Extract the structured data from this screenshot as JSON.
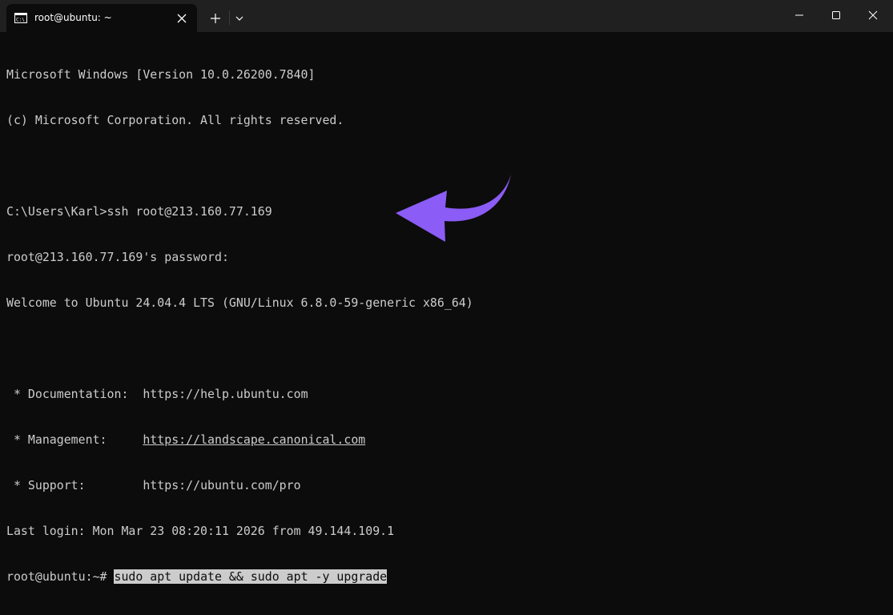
{
  "window": {
    "tab_title": "root@ubuntu: ~",
    "icons": {
      "tab": "terminal-icon",
      "close_tab": "close-icon",
      "new_tab": "plus-icon",
      "dropdown": "chevron-down-icon",
      "minimize": "minimize-icon",
      "maximize": "maximize-icon",
      "close": "close-icon"
    }
  },
  "terminal": {
    "lines": {
      "l1": "Microsoft Windows [Version 10.0.26200.7840]",
      "l2": "(c) Microsoft Corporation. All rights reserved.",
      "l4": "C:\\Users\\Karl>ssh root@213.160.77.169",
      "l5": "root@213.160.77.169's password:",
      "l6": "Welcome to Ubuntu 24.04.4 LTS (GNU/Linux 6.8.0-59-generic x86_64)",
      "doc_label": " * Documentation:  ",
      "doc_url": "https://help.ubuntu.com",
      "mgmt_label": " * Management:     ",
      "mgmt_url": "https://landscape.canonical.com",
      "support_label": " * Support:        ",
      "support_url": "https://ubuntu.com/pro",
      "last_login": "Last login: Mon Mar 23 08:20:11 2026 from 49.144.109.1",
      "prompt": "root@ubuntu:~# ",
      "command": "sudo apt update && sudo apt -y upgrade"
    },
    "colors": {
      "background": "#0c0c0c",
      "text": "#cccccc",
      "selection": "#cccccc",
      "annotation_arrow": "#8b5cf6"
    }
  }
}
